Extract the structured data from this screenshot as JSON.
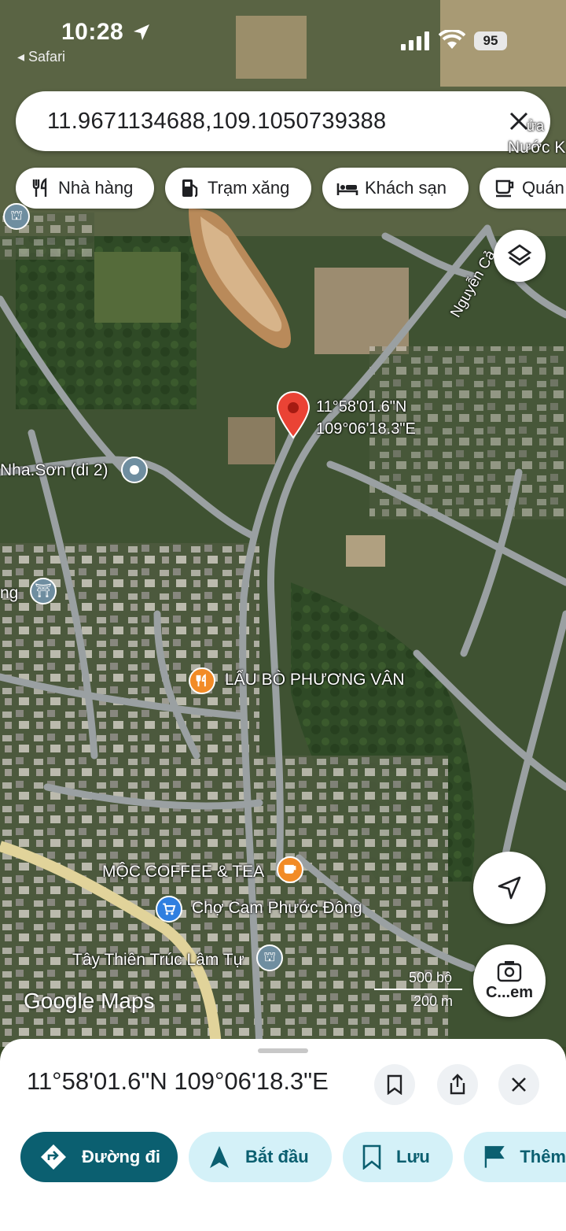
{
  "status_bar": {
    "time": "10:28",
    "back_app": "◂ Safari",
    "battery": "95"
  },
  "search": {
    "value": "11.9671134688,109.1050739388"
  },
  "chips": [
    {
      "label": "Nhà hàng",
      "icon": "restaurant-icon"
    },
    {
      "label": "Trạm xăng",
      "icon": "gas-station-icon"
    },
    {
      "label": "Khách sạn",
      "icon": "hotel-icon"
    },
    {
      "label": "Quán",
      "icon": "coffee-icon"
    }
  ],
  "map": {
    "pin_label_lat": "11°58'01.6\"N",
    "pin_label_lng": "109°06'18.3\"E",
    "road_label": "Nguyễn Cả",
    "top_right_label_1": "ửa",
    "top_right_label_2": "Nước K",
    "places": [
      {
        "name": "Nha.Sơn (di 2)",
        "icon": "place-icon"
      },
      {
        "name": "ng",
        "icon": "monument-icon"
      },
      {
        "name": "LẨU BÒ PHƯƠNG VÂN",
        "icon": "restaurant-icon"
      },
      {
        "name": "MỘC COFFEE & TEA",
        "icon": "coffee-icon"
      },
      {
        "name": "Chợ Cam Phước Đông",
        "icon": "shopping-cart-icon"
      },
      {
        "name": "Tây Thiên Trúc Lâm Tự",
        "icon": "temple-icon"
      }
    ],
    "watermark": "Google Maps",
    "scale_top": "500 bộ",
    "scale_bottom": "200 m",
    "search_image_label": "C...em"
  },
  "sheet": {
    "title": "11°58'01.6\"N 109°06'18.3\"E",
    "actions": [
      {
        "label": "Đường đi",
        "icon": "directions-icon"
      },
      {
        "label": "Bắt đầu",
        "icon": "navigation-arrow-icon"
      },
      {
        "label": "Lưu",
        "icon": "bookmark-icon"
      },
      {
        "label": "Thêm",
        "icon": "flag-icon"
      }
    ]
  },
  "colors": {
    "accent": "#0b5f70",
    "action_bg": "#d4f1f8",
    "pin": "#ea4335",
    "poi_orange": "#f28b26",
    "poi_gray": "#6f8ea0",
    "poi_blue": "#2f7fe0"
  }
}
